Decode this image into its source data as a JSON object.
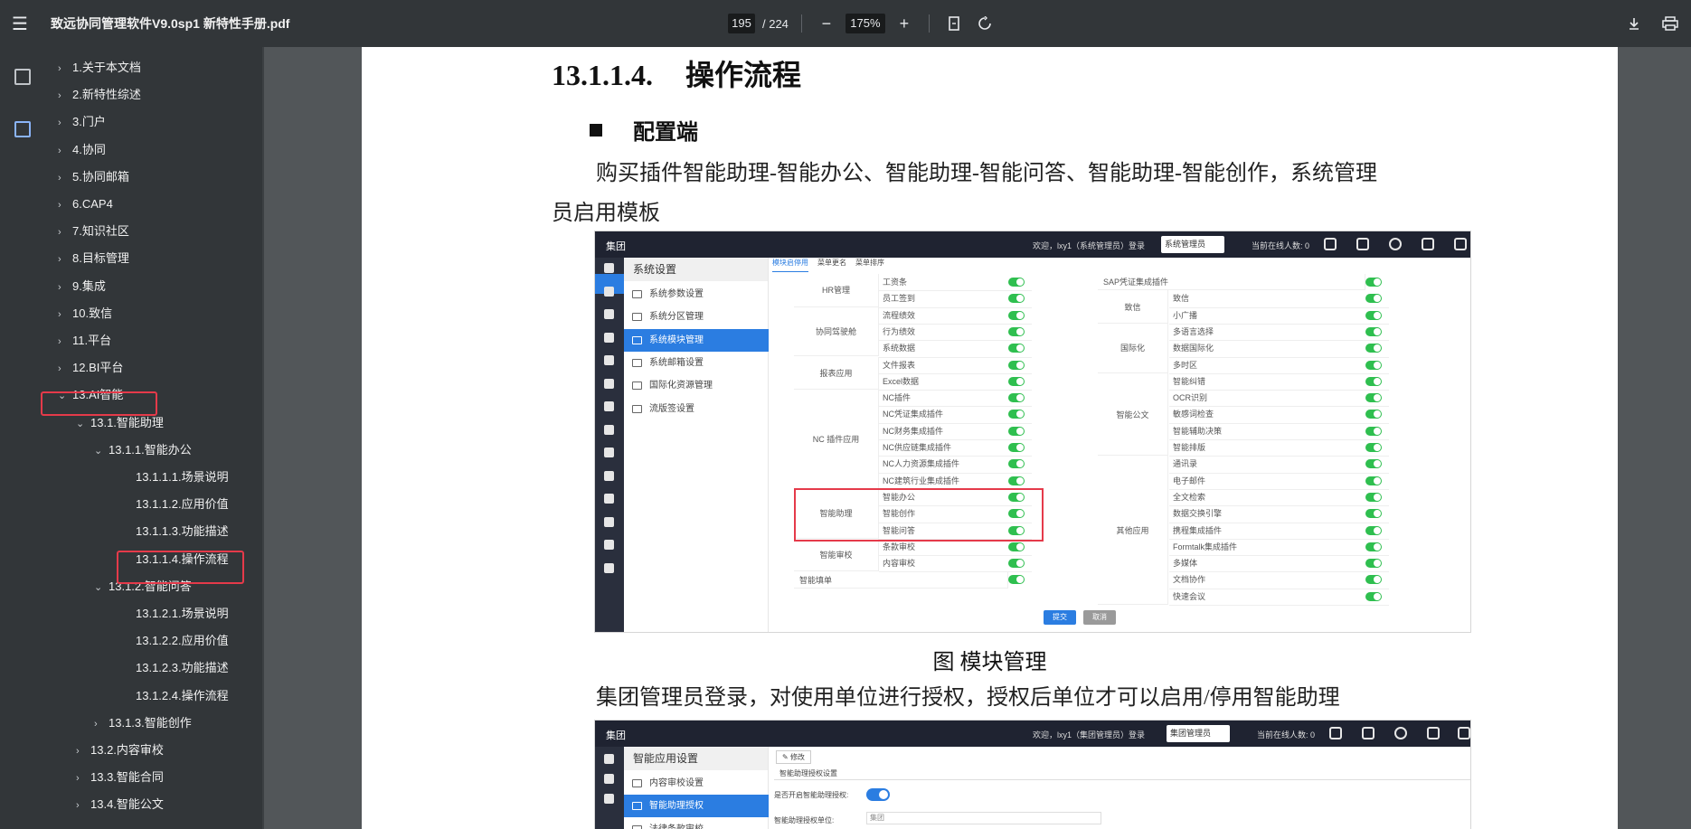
{
  "toolbar": {
    "file_title": "致远协同管理软件V9.0sp1 新特性手册.pdf",
    "current_page": "195",
    "total_pages": "/ 224",
    "zoom": "175%"
  },
  "outline": {
    "items": [
      {
        "label": "1.关于本文档",
        "level": 0,
        "chev": "›"
      },
      {
        "label": "2.新特性综述",
        "level": 0,
        "chev": "›"
      },
      {
        "label": "3.门户",
        "level": 0,
        "chev": "›"
      },
      {
        "label": "4.协同",
        "level": 0,
        "chev": "›"
      },
      {
        "label": "5.协同邮箱",
        "level": 0,
        "chev": "›"
      },
      {
        "label": "6.CAP4",
        "level": 0,
        "chev": "›"
      },
      {
        "label": "7.知识社区",
        "level": 0,
        "chev": "›"
      },
      {
        "label": "8.目标管理",
        "level": 0,
        "chev": "›"
      },
      {
        "label": "9.集成",
        "level": 0,
        "chev": "›"
      },
      {
        "label": "10.致信",
        "level": 0,
        "chev": "›"
      },
      {
        "label": "11.平台",
        "level": 0,
        "chev": "›"
      },
      {
        "label": "12.BI平台",
        "level": 0,
        "chev": "›"
      },
      {
        "label": "13.AI智能",
        "level": 0,
        "chev": "⌄"
      },
      {
        "label": "13.1.智能助理",
        "level": 1,
        "chev": "⌄"
      },
      {
        "label": "13.1.1.智能办公",
        "level": 2,
        "chev": "⌄"
      },
      {
        "label": "13.1.1.1.场景说明",
        "level": 3,
        "chev": ""
      },
      {
        "label": "13.1.1.2.应用价值",
        "level": 3,
        "chev": ""
      },
      {
        "label": "13.1.1.3.功能描述",
        "level": 3,
        "chev": ""
      },
      {
        "label": "13.1.1.4.操作流程",
        "level": 3,
        "chev": ""
      },
      {
        "label": "13.1.2.智能问答",
        "level": 2,
        "chev": "⌄"
      },
      {
        "label": "13.1.2.1.场景说明",
        "level": 3,
        "chev": ""
      },
      {
        "label": "13.1.2.2.应用价值",
        "level": 3,
        "chev": ""
      },
      {
        "label": "13.1.2.3.功能描述",
        "level": 3,
        "chev": ""
      },
      {
        "label": "13.1.2.4.操作流程",
        "level": 3,
        "chev": ""
      },
      {
        "label": "13.1.3.智能创作",
        "level": 2,
        "chev": "›"
      },
      {
        "label": "13.2.内容审校",
        "level": 1,
        "chev": "›"
      },
      {
        "label": "13.3.智能合同",
        "level": 1,
        "chev": "›"
      },
      {
        "label": "13.4.智能公文",
        "level": 1,
        "chev": "›"
      }
    ]
  },
  "doc": {
    "heading_num": "13.1.1.4.",
    "heading_text": "操作流程",
    "bullet": "配置端",
    "para1_line1": "购买插件智能助理-智能办公、智能助理-智能问答、智能助理-智能创作，系统管理",
    "para1_line2": "员启用模板",
    "caption": "图  模块管理",
    "para2": "集团管理员登录，对使用单位进行授权，授权后单位才可以启用/停用智能助理"
  },
  "shot1": {
    "brand": "集团",
    "welcome": "欢迎，lxy1（系统管理员）登录",
    "role": "系统管理员",
    "online": "当前在线人数: 0",
    "menu_title": "系统设置",
    "menu": [
      "系统参数设置",
      "系统分区管理",
      "系统模块管理",
      "系统邮箱设置",
      "国际化资源管理",
      "流版签设置"
    ],
    "tabs": [
      "模块启停用",
      "菜单更名",
      "菜单排序"
    ],
    "left_groups": [
      {
        "group": "HR管理",
        "items": [
          "工资条",
          "员工签到"
        ]
      },
      {
        "group": "协同驾驶舱",
        "items": [
          "流程绩效",
          "行为绩效",
          "系统数据"
        ]
      },
      {
        "group": "报表应用",
        "items": [
          "文件报表",
          "Excel数据"
        ]
      },
      {
        "group": "NC 插件应用",
        "items": [
          "NC插件",
          "NC凭证集成插件",
          "NC财务集成插件",
          "NC供应链集成插件",
          "NC人力资源集成插件",
          "NC建筑行业集成插件"
        ]
      },
      {
        "group": "智能助理",
        "items": [
          "智能办公",
          "智能创作",
          "智能问答"
        ]
      },
      {
        "group": "智能审校",
        "items": [
          "条款审校",
          "内容审校"
        ]
      },
      {
        "group": "智能填单",
        "items": []
      }
    ],
    "right_groups": [
      {
        "group": "SAP凭证集成插件",
        "items": []
      },
      {
        "group": "致信",
        "items": [
          "致信",
          "小广播"
        ]
      },
      {
        "group": "国际化",
        "items": [
          "多语言选择",
          "数据国际化",
          "多时区"
        ]
      },
      {
        "group": "智能公文",
        "items": [
          "智能纠错",
          "OCR识别",
          "敏感词检查",
          "智能辅助决策",
          "智能排版"
        ]
      },
      {
        "group": "其他应用",
        "items": [
          "通讯录",
          "电子邮件",
          "全文检索",
          "数据交换引擎",
          "携程集成插件",
          "Formtalk集成插件",
          "多媒体",
          "文档协作",
          "快速会议"
        ]
      }
    ],
    "submit": "提交",
    "cancel": "取消"
  },
  "shot2": {
    "brand": "集团",
    "welcome": "欢迎，lxy1（集团管理员）登录",
    "role": "集团管理员",
    "online": "当前在线人数: 0",
    "menu_title": "智能应用设置",
    "menu": [
      "内容审校设置",
      "智能助理授权",
      "法律条款审校"
    ],
    "edit": "修改",
    "section": "智能助理授权设置",
    "enable_label": "是否开启智能助理授权:",
    "unit_label": "智能助理授权单位:",
    "unit_value": "集团"
  },
  "colors": {
    "accent": "#2b7de1",
    "highlight": "#e53a4a",
    "toggle_on": "#2fbf4f"
  }
}
